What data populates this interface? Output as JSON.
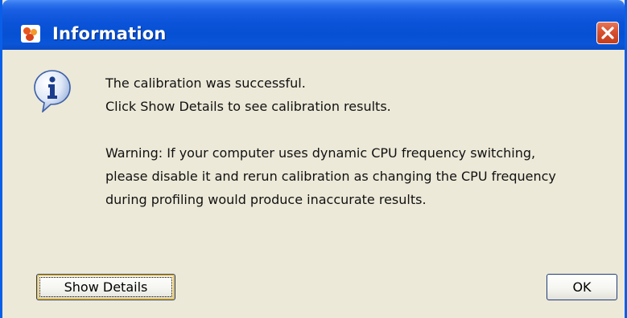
{
  "dialog": {
    "title": "Information",
    "icons": {
      "app": "netbeans-profiler-icon",
      "close": "close-icon",
      "message": "information-icon"
    },
    "message": {
      "line1": "The calibration was successful.",
      "line2": "Click Show Details to see calibration results.",
      "warning1": "Warning: If your computer uses dynamic CPU frequency switching,",
      "warning2": "please disable it and rerun calibration as changing the CPU frequency",
      "warning3": "during profiling would produce inaccurate results."
    },
    "buttons": {
      "show_details": "Show Details",
      "ok": "OK"
    }
  },
  "colors": {
    "titlebar": "#0650d3",
    "dialog_background": "#ece9d8",
    "close_button": "#d6502f",
    "focus_highlight": "#f0c64f"
  }
}
